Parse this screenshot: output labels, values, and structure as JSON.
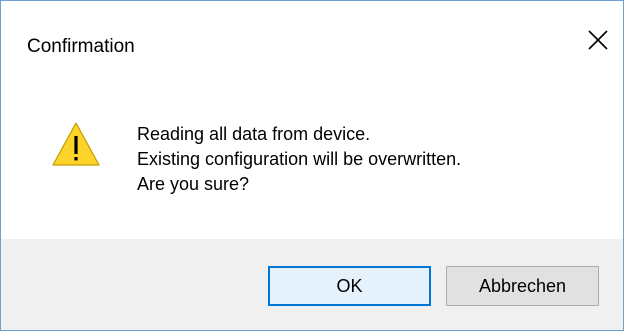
{
  "dialog": {
    "title": "Confirmation",
    "close_icon": "close-icon",
    "warning_icon": "warning-icon",
    "message_lines": [
      "Reading all data from device.",
      "Existing configuration will be overwritten.",
      "Are you sure?"
    ],
    "buttons": {
      "ok_label": "OK",
      "cancel_label": "Abbrechen"
    },
    "colors": {
      "border": "#6f9ed3",
      "footer_bg": "#f0f0f0",
      "default_button_border": "#0078d7",
      "warning_fill": "#ffd42a"
    }
  }
}
